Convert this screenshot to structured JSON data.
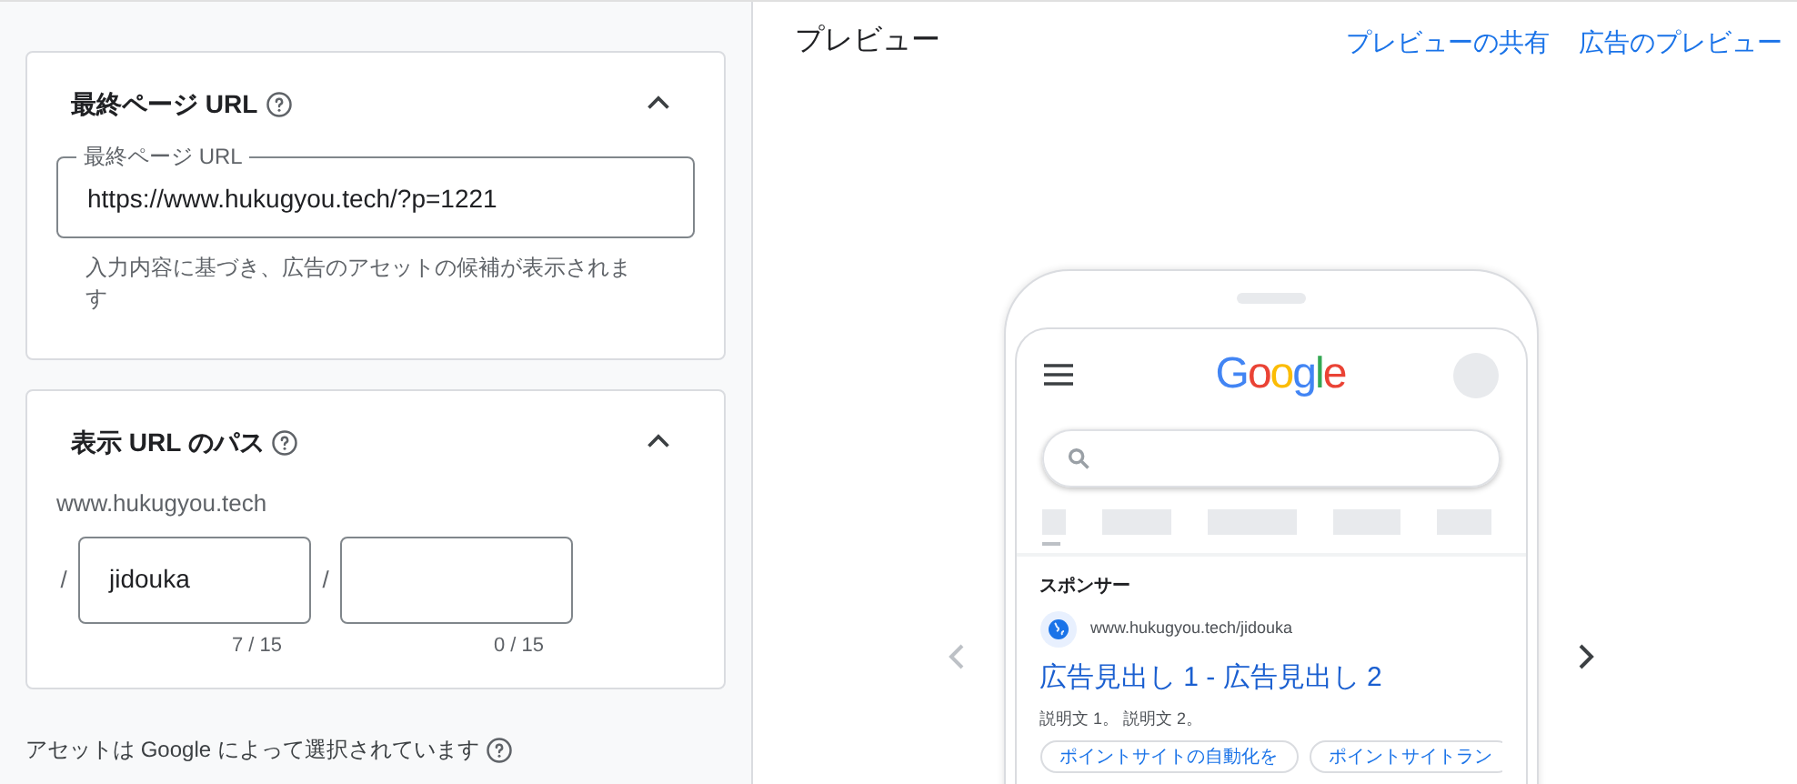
{
  "final_url_section": {
    "title": "最終ページ URL",
    "expanded": true,
    "field": {
      "label": "最終ページ URL",
      "value": "https://www.hukugyou.tech/?p=1221"
    },
    "hint": "入力内容に基づき、広告のアセットの候補が表示されます"
  },
  "display_path_section": {
    "title": "表示 URL のパス",
    "expanded": true,
    "domain": "www.hukugyou.tech",
    "paths": [
      {
        "separator": "/",
        "value": "jidouka",
        "counter": "7 / 15"
      },
      {
        "separator": "/",
        "counter": "0 / 15"
      }
    ]
  },
  "footer_note": "アセットは Google によって選択されています",
  "preview": {
    "title": "プレビュー",
    "links": [
      "プレビューの共有",
      "広告のプレビュー"
    ],
    "phone": {
      "logo": "Google",
      "sponsored_label": "スポンサー",
      "ad": {
        "url": "www.hukugyou.tech/jidouka",
        "headline": "広告見出し 1 - 広告見出し 2",
        "description": "説明文 1。 説明文 2。",
        "sitelinks": [
          "ポイントサイトの自動化を",
          "ポイントサイトラン"
        ]
      }
    }
  }
}
